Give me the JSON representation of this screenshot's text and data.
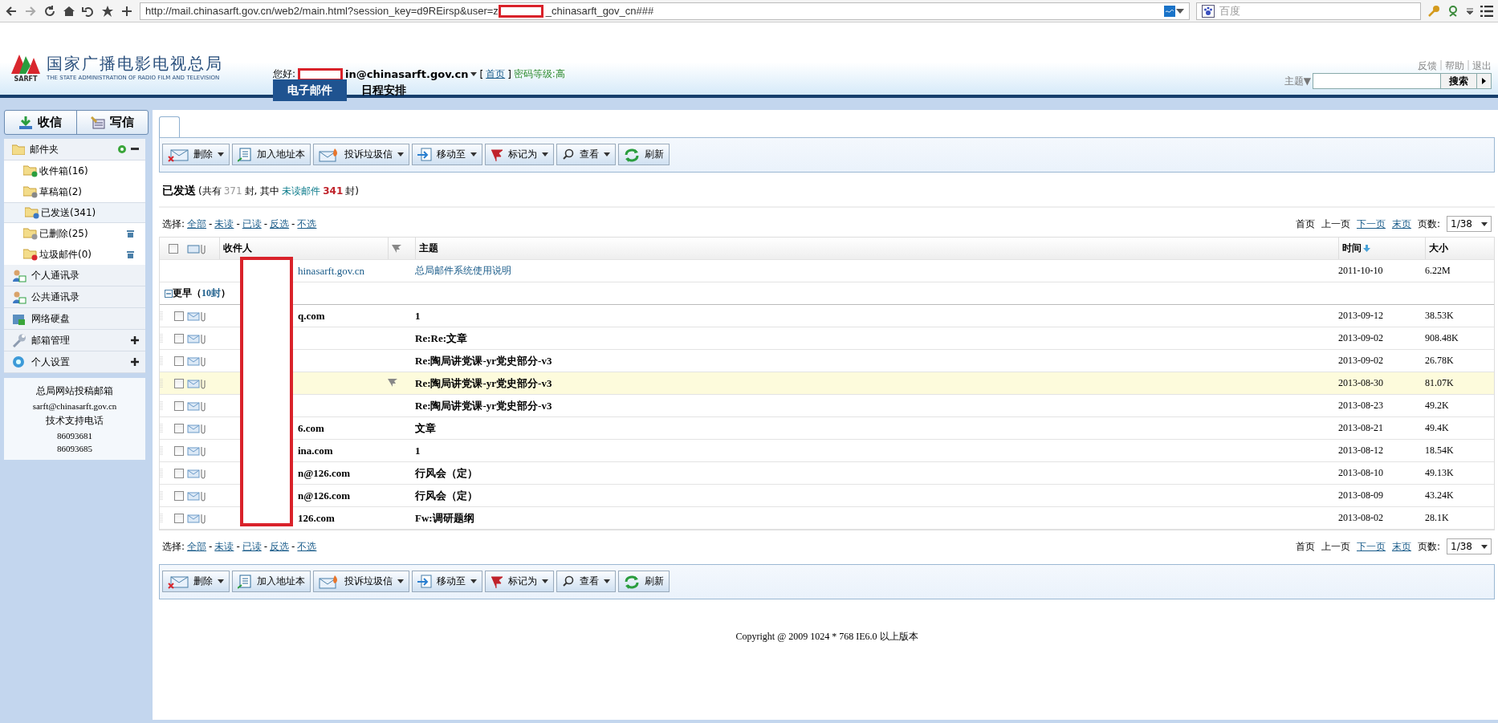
{
  "browser": {
    "url_before": "http://mail.chinasarft.gov.cn/web2/main.html?session_key=d9REirsp&user=z",
    "url_after": "_chinasarft_gov_cn###",
    "search_placeholder": "百度"
  },
  "header": {
    "logo_cn": "国家广播电影电视总局",
    "logo_en": "THE STATE ADMINISTRATION OF RADIO FILM AND TELEVISION",
    "logo_mark": "SARFT",
    "greeting": "您好:",
    "account": "in@chinasarft.gov.cn",
    "bracket_open": "[",
    "home_link": "首页",
    "bracket_close": "]",
    "password_level": "密码等级:高",
    "top_links": [
      {
        "label": "反馈"
      },
      {
        "separator": "|",
        "label": "帮助"
      },
      {
        "separator": "|",
        "label": "退出"
      }
    ],
    "nav_tabs": [
      {
        "label": "电子邮件",
        "selected": true
      },
      {
        "label": "日程安排",
        "selected": false
      }
    ],
    "search": {
      "scope": "主题▼",
      "button": "搜索"
    }
  },
  "sidebar": {
    "buttons": [
      {
        "label": "收信",
        "kind": "receive"
      },
      {
        "label": "写信",
        "kind": "compose"
      }
    ],
    "folder_header": "邮件夹",
    "folders": [
      {
        "label": "收件箱(16)",
        "kind": "inbox",
        "selected": false,
        "clearable": false
      },
      {
        "label": "草稿箱(2)",
        "kind": "drafts",
        "selected": false,
        "clearable": false
      },
      {
        "label": "已发送(341)",
        "kind": "sent",
        "selected": true,
        "clearable": false
      },
      {
        "label": "已删除(25)",
        "kind": "deleted",
        "selected": false,
        "clearable": true
      },
      {
        "label": "垃圾邮件(0)",
        "kind": "spam",
        "selected": false,
        "clearable": true
      }
    ],
    "sections": [
      {
        "label": "个人通讯录",
        "kind": "contacts",
        "expandable": false
      },
      {
        "label": "公共通讯录",
        "kind": "contacts",
        "expandable": false
      },
      {
        "label": "网络硬盘",
        "kind": "disk",
        "expandable": false
      },
      {
        "label": "邮箱管理",
        "kind": "tools",
        "expandable": true
      },
      {
        "label": "个人设置",
        "kind": "settings",
        "expandable": true
      }
    ],
    "info": [
      "总局网站投稿邮箱",
      "sarft@chinasarft.gov.cn",
      "技术支持电话",
      "86093681",
      "86093685"
    ]
  },
  "toolbar_top": [
    {
      "label": "删除",
      "kind": "delete",
      "dropdown": true
    },
    {
      "label": "加入地址本",
      "kind": "address",
      "dropdown": false
    },
    {
      "label": "投诉垃圾信",
      "kind": "spam",
      "dropdown": true
    },
    {
      "label": "移动至",
      "kind": "move",
      "dropdown": true
    },
    {
      "label": "标记为",
      "kind": "flag",
      "dropdown": true
    },
    {
      "label": "查看",
      "kind": "view",
      "dropdown": true
    },
    {
      "label": "刷新",
      "kind": "refresh",
      "dropdown": false
    }
  ],
  "summary": {
    "title": "已发送",
    "parts": [
      {
        "text": "(共有",
        "kind": "plain"
      },
      {
        "text": "371",
        "kind": "total"
      },
      {
        "text": "封, 其中",
        "kind": "plain"
      },
      {
        "text": "未读邮件",
        "kind": "unread_label"
      },
      {
        "text": "341",
        "kind": "unread"
      },
      {
        "text": "封)",
        "kind": "plain"
      }
    ]
  },
  "select_top": {
    "label": "选择:",
    "links": [
      {
        "label": "全部"
      },
      {
        "prefix": "-",
        "label": "未读"
      },
      {
        "prefix": "-",
        "label": "已读"
      },
      {
        "prefix": "-",
        "label": "反选"
      },
      {
        "prefix": "-",
        "label": "不选"
      }
    ]
  },
  "pager_top": {
    "items": [
      {
        "label": "首页",
        "enabled": false
      },
      {
        "label": "上一页",
        "enabled": false
      },
      {
        "label": "下一页",
        "enabled": true
      },
      {
        "label": "末页",
        "enabled": true
      }
    ],
    "page_label": "页数:",
    "page": "1/38"
  },
  "table": {
    "header_checked": false,
    "columns": [
      {
        "label": "收件人",
        "sorted": false
      },
      {
        "label": "主题",
        "sorted": false
      },
      {
        "label": "时间",
        "sorted": true
      },
      {
        "label": "大小",
        "sorted": false
      }
    ],
    "notice": {
      "sender": "hinasarft.gov.cn",
      "subject": "总局邮件系统使用说明",
      "time": "2011-10-10",
      "size": "6.22M"
    },
    "group": {
      "label": "更早（",
      "count": "10封",
      "close": "）",
      "expanded": true
    },
    "rows": [
      {
        "sender": "q.com",
        "subject": "1",
        "time": "2013-09-12",
        "size": "38.53K",
        "checked": false,
        "selected": false,
        "flagged": false
      },
      {
        "subject": "Re:Re:文章",
        "time": "2013-09-02",
        "size": "908.48K",
        "checked": false,
        "selected": false,
        "flagged": false
      },
      {
        "subject": "Re:陶局讲党课-yr党史部分-v3",
        "time": "2013-09-02",
        "size": "26.78K",
        "checked": false,
        "selected": false,
        "flagged": false
      },
      {
        "subject": "Re:陶局讲党课-yr党史部分-v3",
        "time": "2013-08-30",
        "size": "81.07K",
        "checked": false,
        "selected": true,
        "flagged": true
      },
      {
        "subject": "Re:陶局讲党课-yr党史部分-v3",
        "time": "2013-08-23",
        "size": "49.2K",
        "checked": false,
        "selected": false,
        "flagged": false
      },
      {
        "sender": "6.com",
        "subject": "文章",
        "time": "2013-08-21",
        "size": "49.4K",
        "checked": false,
        "selected": false,
        "flagged": false
      },
      {
        "sender": "ina.com",
        "subject": "1",
        "time": "2013-08-12",
        "size": "18.54K",
        "checked": false,
        "selected": false,
        "flagged": false
      },
      {
        "sender": "n@126.com",
        "subject": "行风会（定）",
        "time": "2013-08-10",
        "size": "49.13K",
        "checked": false,
        "selected": false,
        "flagged": false
      },
      {
        "sender": "n@126.com",
        "subject": "行风会（定）",
        "time": "2013-08-09",
        "size": "43.24K",
        "checked": false,
        "selected": false,
        "flagged": false
      },
      {
        "sender": "126.com",
        "subject": "Fw:调研题纲",
        "time": "2013-08-02",
        "size": "28.1K",
        "checked": false,
        "selected": false,
        "flagged": false
      }
    ]
  },
  "select_bottom": {
    "label": "选择:",
    "links": [
      {
        "label": "全部"
      },
      {
        "prefix": "-",
        "label": "未读"
      },
      {
        "prefix": "-",
        "label": "已读"
      },
      {
        "prefix": "-",
        "label": "反选"
      },
      {
        "prefix": "-",
        "label": "不选"
      }
    ]
  },
  "pager_bottom": {
    "items": [
      {
        "label": "首页",
        "enabled": false
      },
      {
        "label": "上一页",
        "enabled": false
      },
      {
        "label": "下一页",
        "enabled": true
      },
      {
        "label": "末页",
        "enabled": true
      }
    ],
    "page_label": "页数:",
    "page": "1/38"
  },
  "toolbar_bottom": [
    {
      "label": "删除",
      "kind": "delete",
      "dropdown": true
    },
    {
      "label": "加入地址本",
      "kind": "address",
      "dropdown": false
    },
    {
      "label": "投诉垃圾信",
      "kind": "spam",
      "dropdown": true
    },
    {
      "label": "移动至",
      "kind": "move",
      "dropdown": true
    },
    {
      "label": "标记为",
      "kind": "flag",
      "dropdown": true
    },
    {
      "label": "查看",
      "kind": "view",
      "dropdown": true
    },
    {
      "label": "刷新",
      "kind": "refresh",
      "dropdown": false
    }
  ],
  "copyright": "Copyright @ 2009 1024 * 768 IE6.0 以上版本"
}
